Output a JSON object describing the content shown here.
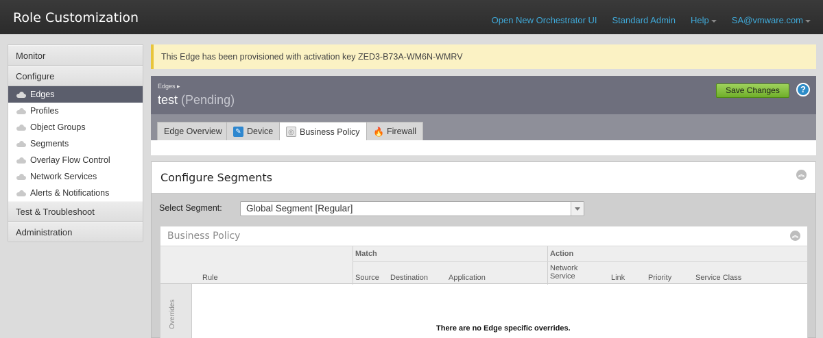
{
  "app": {
    "title": "Role Customization"
  },
  "topnav": {
    "open_ui": "Open New Orchestrator UI",
    "role": "Standard Admin",
    "help": "Help",
    "user": "SA@vmware.com"
  },
  "sidebar": {
    "monitor": "Monitor",
    "configure": "Configure",
    "items": [
      {
        "label": "Edges",
        "icon": "cloud-icon"
      },
      {
        "label": "Profiles",
        "icon": "cloud-icon"
      },
      {
        "label": "Object Groups",
        "icon": "cloud-icon"
      },
      {
        "label": "Segments",
        "icon": "cloud-icon"
      },
      {
        "label": "Overlay Flow Control",
        "icon": "cloud-icon"
      },
      {
        "label": "Network Services",
        "icon": "cloud-icon"
      },
      {
        "label": "Alerts & Notifications",
        "icon": "cloud-icon"
      }
    ],
    "test": "Test & Troubleshoot",
    "administration": "Administration"
  },
  "notice": {
    "text": "This Edge has been provisioned with activation key ZED3-B73A-WM6N-WMRV"
  },
  "edge": {
    "breadcrumb": "Edges",
    "name": "test",
    "status": "(Pending)",
    "save_label": "Save Changes",
    "help_label": "?"
  },
  "tabs": [
    {
      "label": "Edge Overview"
    },
    {
      "label": "Device"
    },
    {
      "label": "Business Policy"
    },
    {
      "label": "Firewall"
    }
  ],
  "segments": {
    "title": "Configure Segments",
    "select_label": "Select Segment:",
    "selected": "Global Segment [Regular]"
  },
  "business_policy": {
    "title": "Business Policy",
    "groups": {
      "match": "Match",
      "action": "Action"
    },
    "columns": {
      "rule": "Rule",
      "source": "Source",
      "destination": "Destination",
      "application": "Application",
      "network_service_1": "Network",
      "network_service_2": "Service",
      "link": "Link",
      "priority": "Priority",
      "service_class": "Service Class"
    },
    "side_label": "Overrides",
    "empty_message": "There are no Edge specific overrides."
  },
  "colors": {
    "accent": "#3fa9d8",
    "active_nav": "#5b5e6c",
    "save": "#7dbd35",
    "notice": "#fbf2c4"
  }
}
